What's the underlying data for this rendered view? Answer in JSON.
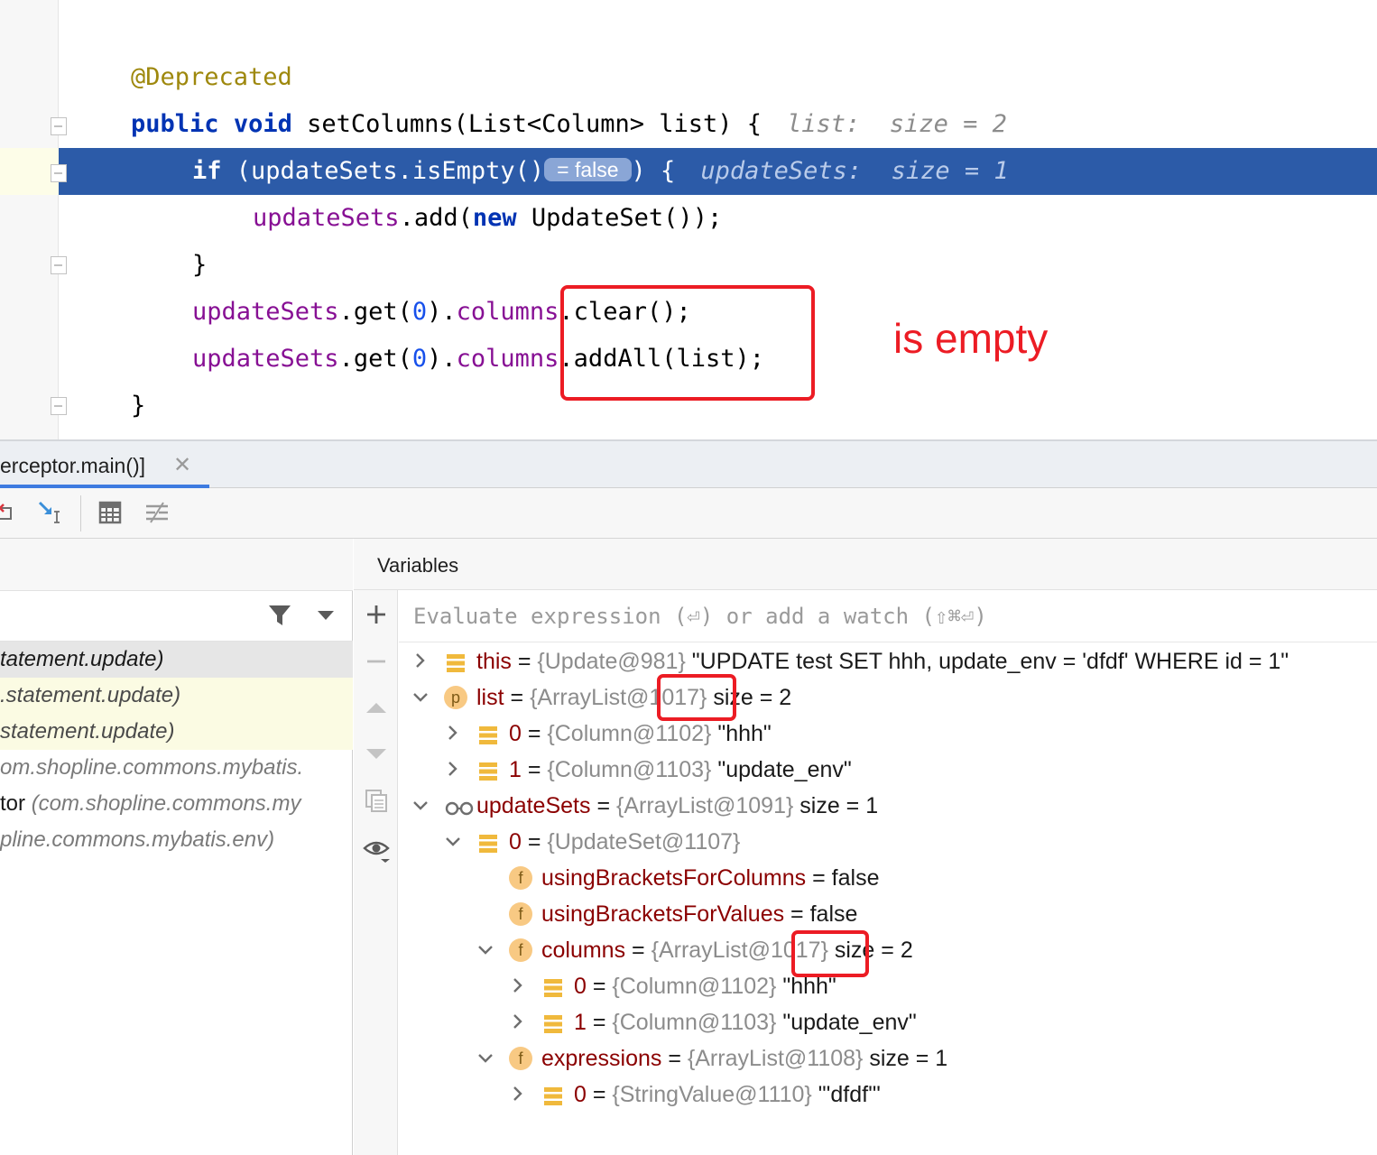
{
  "editor": {
    "lines": [
      {
        "tokens": [
          {
            "t": "@Deprecated",
            "c": "ann"
          }
        ]
      },
      {
        "tokens": [
          {
            "t": "public",
            "c": "kw"
          },
          {
            "t": " "
          },
          {
            "t": "void",
            "c": "kw"
          },
          {
            "t": " setColumns(List<Column> list) {"
          }
        ],
        "hint": "list:  size = 2"
      },
      {
        "tokens": [
          {
            "t": "if",
            "c": "kw"
          },
          {
            "t": " (updateSets.isEmpty()"
          }
        ],
        "inlay": "= false",
        "after": ") {",
        "hint": "updateSets:  size = 1",
        "exec": true
      },
      {
        "tokens": [
          {
            "t": "updateSets",
            "c": "fld"
          },
          {
            "t": ".add("
          },
          {
            "t": "new",
            "c": "kw"
          },
          {
            "t": " UpdateSet());"
          }
        ]
      },
      {
        "tokens": [
          {
            "t": "}"
          }
        ]
      },
      {
        "tokens": [
          {
            "t": "updateSets",
            "c": "fld"
          },
          {
            "t": ".get("
          },
          {
            "t": "0",
            "c": "num"
          },
          {
            "t": ")."
          },
          {
            "t": "columns",
            "c": "fld"
          },
          {
            "t": ".clear();"
          }
        ]
      },
      {
        "tokens": [
          {
            "t": "updateSets",
            "c": "fld"
          },
          {
            "t": ".get("
          },
          {
            "t": "0",
            "c": "num"
          },
          {
            "t": ")."
          },
          {
            "t": "columns",
            "c": "fld"
          },
          {
            "t": ".addAll(list);"
          }
        ]
      },
      {
        "tokens": [
          {
            "t": "}"
          }
        ]
      }
    ],
    "annotation": "is empty"
  },
  "tab": {
    "label": "erceptor.main()]",
    "close": "✕"
  },
  "toolbar": {
    "icons": [
      "drop-frame-icon",
      "force-step-into-icon",
      "evaluate-icon",
      "trace-icon"
    ]
  },
  "frames": {
    "items": [
      {
        "main": "tatement.update)",
        "style": "sel"
      },
      {
        "main": ".statement.update)",
        "style": "lib"
      },
      {
        "main": "statement.update)",
        "style": "lib"
      },
      {
        "main": "om.shopline.commons.mybatis.",
        "style": "dim"
      },
      {
        "prefix": "tor ",
        "main": "(com.shopline.commons.my",
        "style": "dim"
      },
      {
        "main": "pline.commons.mybatis.env)",
        "style": "dim"
      }
    ]
  },
  "variables": {
    "title": "Variables",
    "eval_placeholder": "Evaluate expression (⏎) or add a watch (⇧⌘⏎)",
    "rows": [
      {
        "indent": 0,
        "arrow": "right",
        "icon": "stack",
        "name": "this",
        "type": "{Update@981}",
        "value": "\"UPDATE test SET hhh, update_env = 'dfdf' WHERE id = 1\""
      },
      {
        "indent": 0,
        "arrow": "down",
        "icon": "p",
        "name": "list",
        "type": "{ArrayList@1017}",
        "value": "size = 2"
      },
      {
        "indent": 1,
        "arrow": "right",
        "icon": "stack",
        "name": "0",
        "type": "{Column@1102}",
        "value": "\"hhh\""
      },
      {
        "indent": 1,
        "arrow": "right",
        "icon": "stack",
        "name": "1",
        "type": "{Column@1103}",
        "value": "\"update_env\""
      },
      {
        "indent": 0,
        "arrow": "down",
        "icon": "watch",
        "name": "updateSets",
        "type": "{ArrayList@1091}",
        "value": "size = 1"
      },
      {
        "indent": 1,
        "arrow": "down",
        "icon": "stack",
        "name": "0",
        "type": "{UpdateSet@1107}",
        "value": ""
      },
      {
        "indent": 2,
        "arrow": "none",
        "icon": "f",
        "name": "usingBracketsForColumns",
        "type": "",
        "value": "false"
      },
      {
        "indent": 2,
        "arrow": "none",
        "icon": "f",
        "name": "usingBracketsForValues",
        "type": "",
        "value": "false"
      },
      {
        "indent": 2,
        "arrow": "down",
        "icon": "f",
        "name": "columns",
        "type": "{ArrayList@1017}",
        "value": "size = 2"
      },
      {
        "indent": 3,
        "arrow": "right",
        "icon": "stack",
        "name": "0",
        "type": "{Column@1102}",
        "value": "\"hhh\""
      },
      {
        "indent": 3,
        "arrow": "right",
        "icon": "stack",
        "name": "1",
        "type": "{Column@1103}",
        "value": "\"update_env\""
      },
      {
        "indent": 2,
        "arrow": "down",
        "icon": "f",
        "name": "expressions",
        "type": "{ArrayList@1108}",
        "value": "size = 1"
      },
      {
        "indent": 3,
        "arrow": "right",
        "icon": "stack",
        "name": "0",
        "type": "{StringValue@1110}",
        "value": "\"'dfdf'\""
      }
    ]
  },
  "colors": {
    "highlight": "#2c5ba8",
    "annotation_red": "#ec1c24",
    "field_purple": "#871094",
    "keyword_blue": "#0033b3"
  }
}
